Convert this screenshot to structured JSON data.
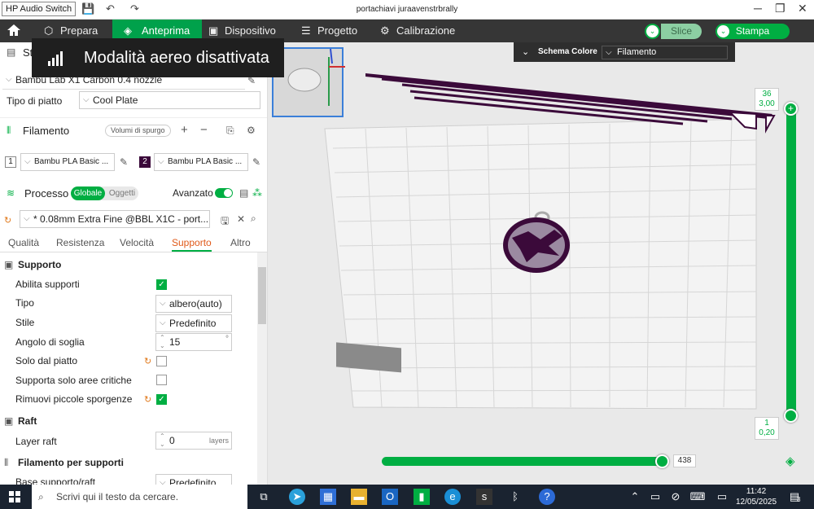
{
  "titlebar": {
    "tooltip": "HP Audio Switch",
    "title": "portachiavi juraavenstrbrally"
  },
  "menubar": {
    "items": [
      {
        "label": "Prepara",
        "icon": "cube-icon"
      },
      {
        "label": "Anteprima",
        "icon": "layers-icon"
      },
      {
        "label": "Dispositivo",
        "icon": "device-icon"
      },
      {
        "label": "Progetto",
        "icon": "project-icon"
      },
      {
        "label": "Calibrazione",
        "icon": "calibration-icon"
      }
    ],
    "slice_label": "Slice",
    "print_label": "Stampa"
  },
  "toast": {
    "text": "Modalità aereo disattivata"
  },
  "schema": {
    "label": "Schema Colore",
    "value": "Filamento"
  },
  "left": {
    "printer_section_label": "Stampante",
    "printer": "Bambu Lab X1 Carbon 0.4 nozzle",
    "plate_label": "Tipo di piatto",
    "plate_value": "Cool Plate",
    "filament_label": "Filamento",
    "purge_label": "Volumi di spurgo",
    "filaments": [
      {
        "num": "1",
        "name": "Bambu PLA Basic ...",
        "color": "#ffffff"
      },
      {
        "num": "2",
        "name": "Bambu PLA Basic ...",
        "color": "#3b0a3a"
      }
    ],
    "process_label": "Processo",
    "scope_global": "Globale",
    "scope_objects": "Oggetti",
    "advanced_label": "Avanzato",
    "profile": "* 0.08mm Extra Fine @BBL X1C - port...",
    "tabs": [
      "Qualità",
      "Resistenza",
      "Velocità",
      "Supporto",
      "Altro"
    ],
    "support_group": "Supporto",
    "enable_supports": "Abilita supporti",
    "type_label": "Tipo",
    "type_value": "albero(auto)",
    "style_label": "Stile",
    "style_value": "Predefinito",
    "angle_label": "Angolo di soglia",
    "angle_value": "15",
    "angle_unit": "°",
    "plate_only": "Solo dal piatto",
    "critical_only": "Supporta solo aree critiche",
    "remove_small": "Rimuovi piccole sporgenze",
    "raft_group": "Raft",
    "raft_layers_label": "Layer raft",
    "raft_layers_value": "0",
    "raft_layers_unit": "layers",
    "support_filament_group": "Filamento per supporti",
    "base_label": "Base supporto/raft",
    "base_value": "Predefinito"
  },
  "viewport": {
    "layer_top": "36",
    "height_top": "3,00",
    "layer_bottom": "1",
    "height_bottom": "0,20",
    "move_count": "438"
  },
  "taskbar": {
    "search_placeholder": "Scrivi qui il testo da cercare.",
    "time": "11:42",
    "date": "12/05/2025",
    "notifications": "3"
  }
}
